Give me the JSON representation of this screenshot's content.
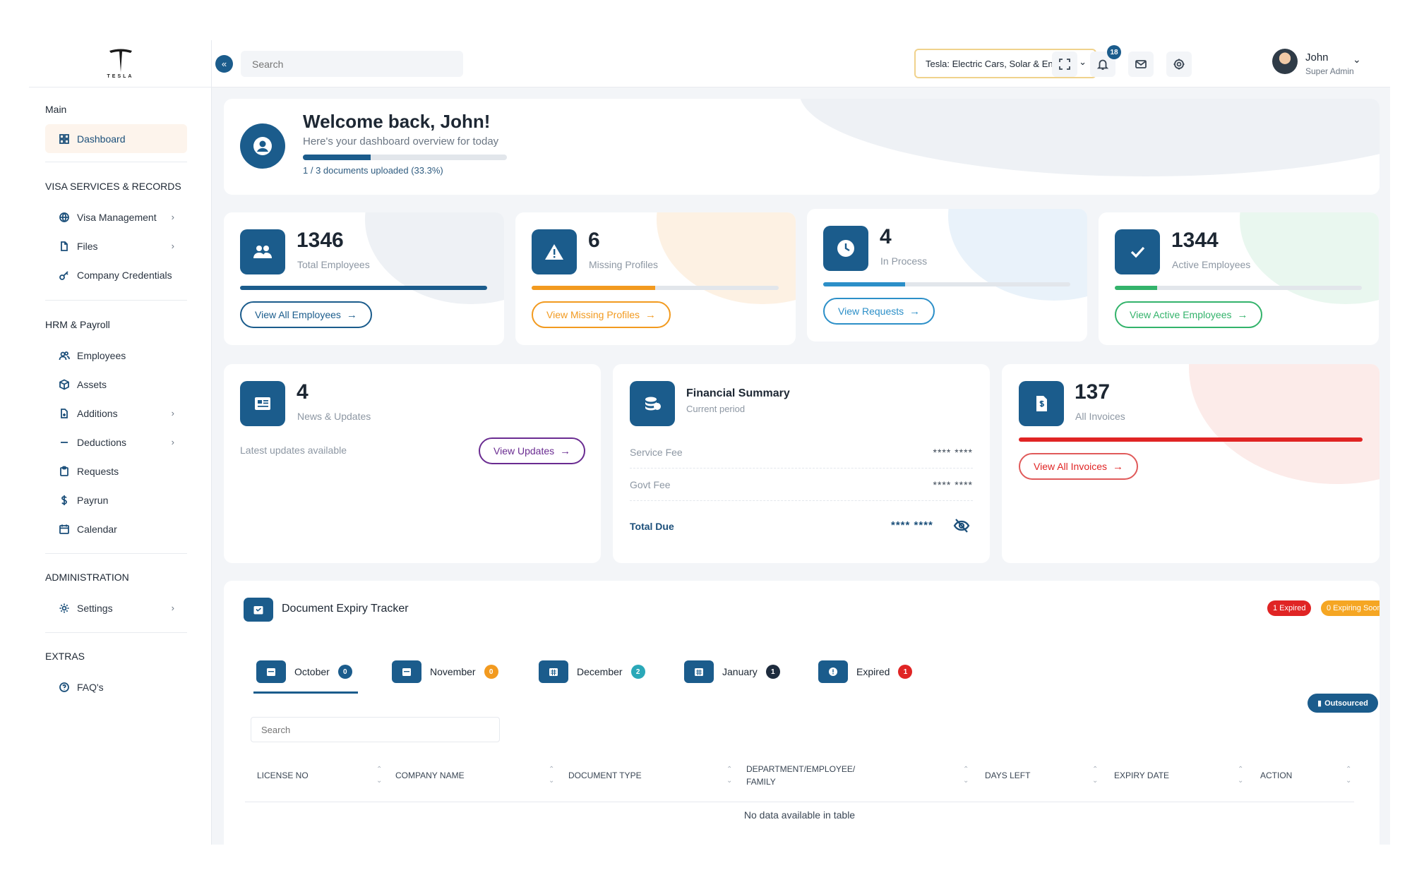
{
  "brand": {
    "logo_text": "TESLA"
  },
  "sidebar": {
    "sections": {
      "main": "Main",
      "visa": "VISA SERVICES & RECORDS",
      "hrm": "HRM & Payroll",
      "admin": "ADMINISTRATION",
      "extras": "EXTRAS"
    },
    "items": [
      {
        "label": "Dashboard",
        "icon": "grid-icon",
        "active": true
      },
      {
        "label": "Visa Management",
        "icon": "globe-icon",
        "chevron": true
      },
      {
        "label": "Files",
        "icon": "file-icon",
        "chevron": true
      },
      {
        "label": "Company Credentials",
        "icon": "key-icon"
      },
      {
        "label": "Employees",
        "icon": "users-icon"
      },
      {
        "label": "Assets",
        "icon": "box-icon"
      },
      {
        "label": "Additions",
        "icon": "file-plus-icon",
        "chevron": true
      },
      {
        "label": "Deductions",
        "icon": "minus-icon",
        "chevron": true
      },
      {
        "label": "Requests",
        "icon": "clipboard-icon"
      },
      {
        "label": "Payrun",
        "icon": "dollar-icon"
      },
      {
        "label": "Calendar",
        "icon": "calendar-icon"
      },
      {
        "label": "Settings",
        "icon": "gear-icon",
        "chevron": true
      },
      {
        "label": "FAQ's",
        "icon": "help-icon"
      }
    ]
  },
  "topbar": {
    "search_placeholder": "Search",
    "company": "Tesla: Electric Cars, Solar & Energy",
    "notifications": "18",
    "user_name": "John",
    "user_role": "Super Admin"
  },
  "welcome": {
    "title": "Welcome back, John!",
    "subtitle": "Here's your dashboard overview for today",
    "progress_text": "1 / 3 documents uploaded (33.3%)",
    "progress_fraction": 0.333
  },
  "stats": [
    {
      "value": "1346",
      "label": "Total Employees",
      "button": "View All Employees",
      "color": "#1b5c8c",
      "fraction": 1.0
    },
    {
      "value": "6",
      "label": "Missing Profiles",
      "button": "View Missing Profiles",
      "color": "#f29a1f",
      "fraction": 0.5
    },
    {
      "value": "4",
      "label": "In Process",
      "button": "View Requests",
      "color": "#2c8fc8",
      "fraction": 0.33
    },
    {
      "value": "1344",
      "label": "Active Employees",
      "button": "View Active Employees",
      "color": "#33b36b",
      "fraction": 0.17
    }
  ],
  "news": {
    "value": "4",
    "label": "News & Updates",
    "note": "Latest updates available",
    "button": "View Updates",
    "color": "#6a2c91"
  },
  "financial": {
    "title": "Financial Summary",
    "subtitle": "Current period",
    "rows": [
      {
        "label": "Service Fee",
        "value": "**** ****"
      },
      {
        "label": "Govt Fee",
        "value": "**** ****"
      }
    ],
    "total_label": "Total Due",
    "total_value": "**** ****"
  },
  "invoices": {
    "value": "137",
    "label": "All Invoices",
    "button": "View All Invoices",
    "color": "#e02424",
    "fraction": 1.0
  },
  "tracker": {
    "title": "Document Expiry Tracker",
    "tag_expired": "1 Expired",
    "tag_soon": "0 Expiring Soon",
    "tabs": [
      {
        "label": "October",
        "count": "0",
        "color": "#1b5c8c"
      },
      {
        "label": "November",
        "count": "0",
        "color": "#f29a1f"
      },
      {
        "label": "December",
        "count": "2",
        "color": "#2aa8b8"
      },
      {
        "label": "January",
        "count": "1",
        "color": "#1d2b3d"
      },
      {
        "label": "Expired",
        "count": "1",
        "color": "#e02424"
      }
    ],
    "outsourced": "Outsourced",
    "search_placeholder": "Search",
    "columns": [
      "License No",
      "Company Name",
      "Document Type",
      "Department/Employee/ Family",
      "Days Left",
      "Expiry Date",
      "Action"
    ],
    "empty_text": "No data available in table"
  }
}
